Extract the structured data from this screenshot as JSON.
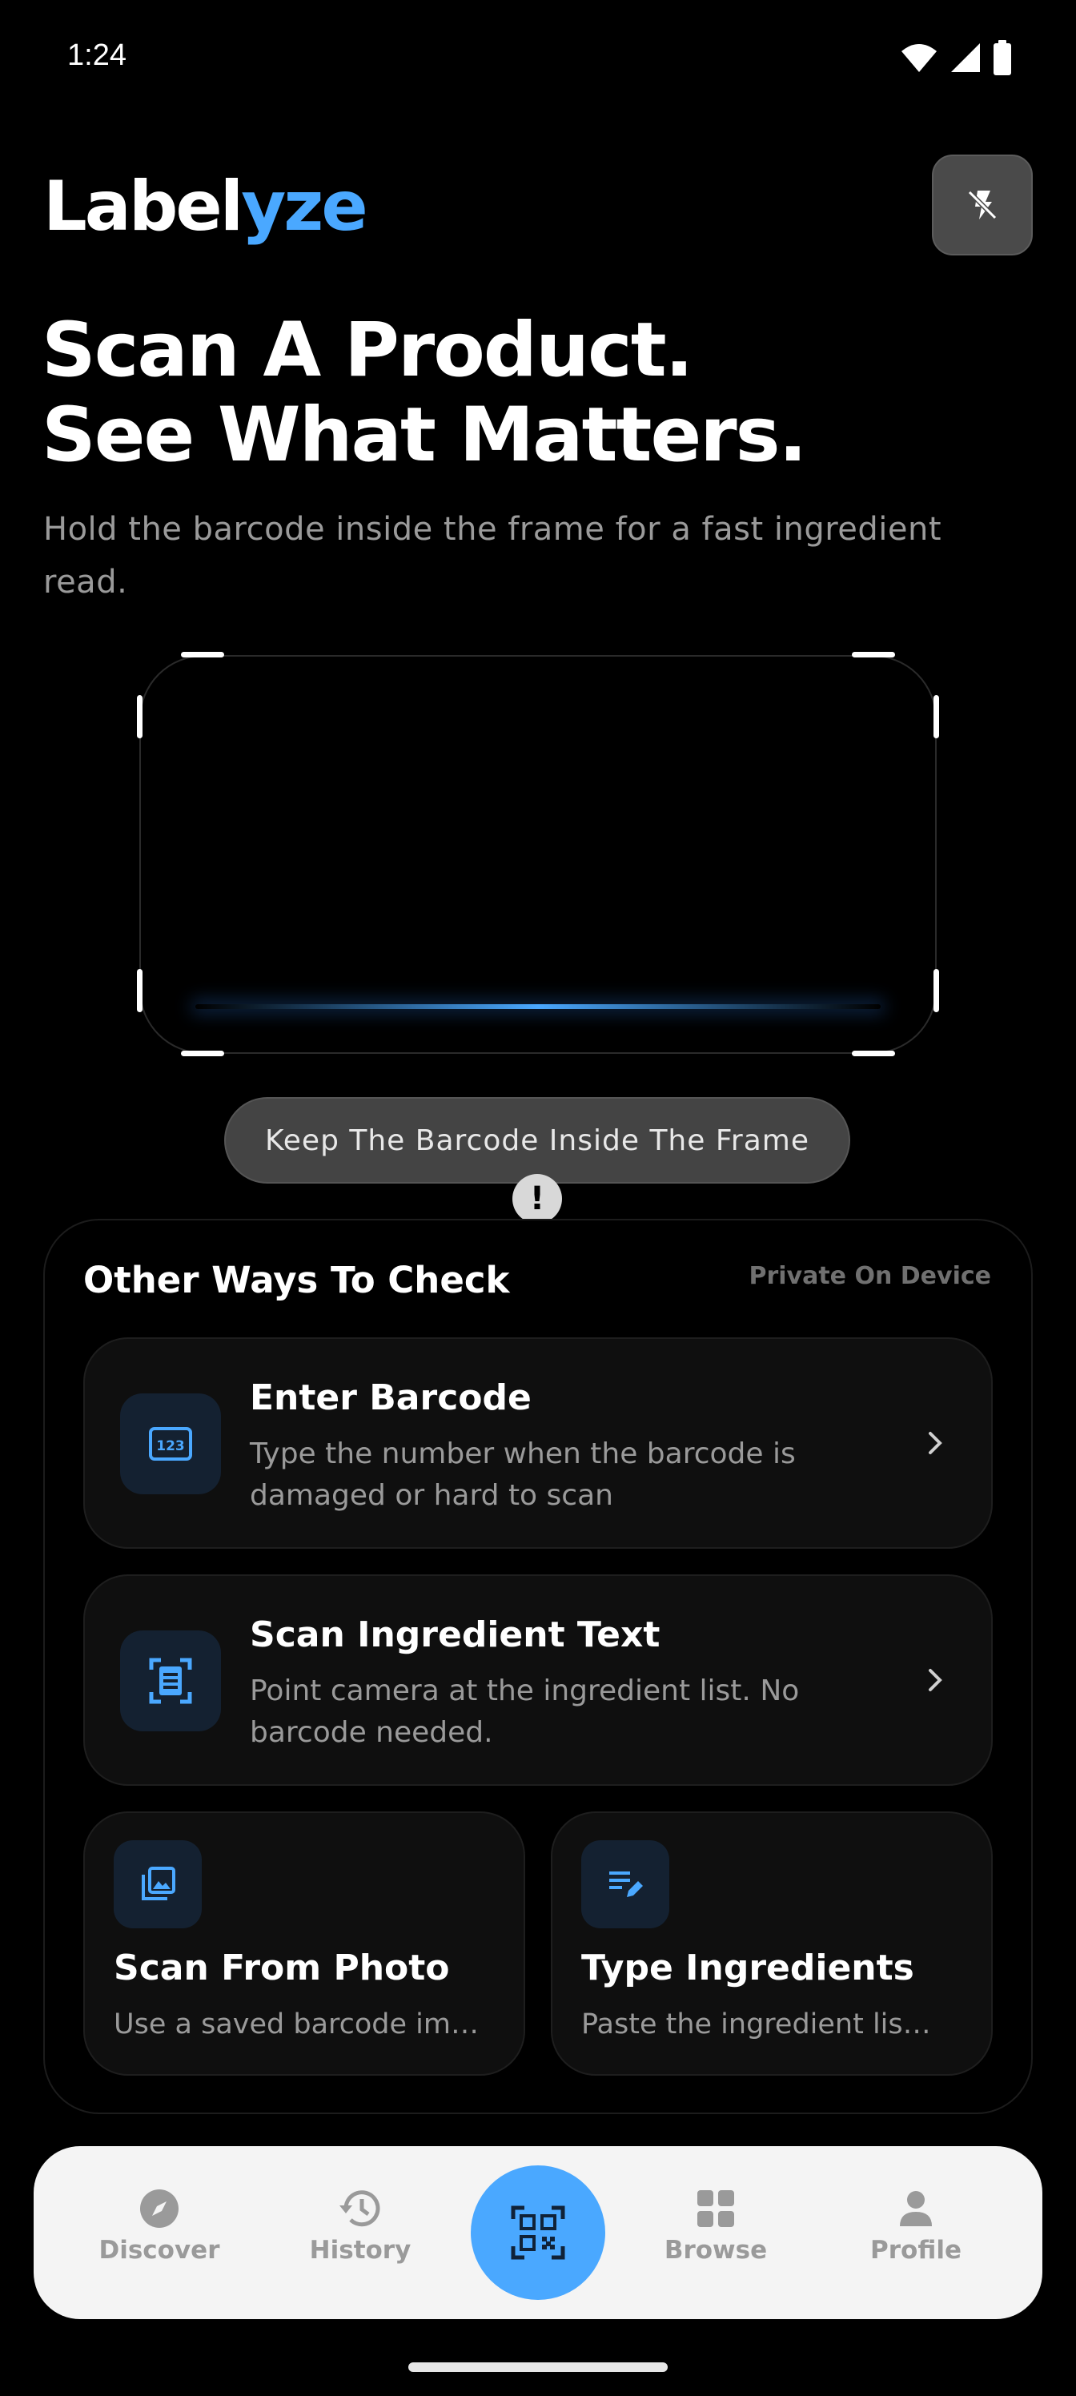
{
  "status_bar": {
    "time": "1:24"
  },
  "header": {
    "logo_main": "Label",
    "logo_accent": "yze",
    "flash_icon": "flash-off-icon"
  },
  "hero": {
    "headline_line1": "Scan A Product.",
    "headline_line2": "See What Matters.",
    "subline": "Hold the barcode inside the frame for a fast ingredient read."
  },
  "scanner": {
    "hint": "Keep The Barcode Inside The Frame",
    "hint_icon_glyph": "!"
  },
  "other_ways": {
    "title": "Other Ways To Check",
    "badge": "Private On Device",
    "options": [
      {
        "title": "Enter Barcode",
        "desc": "Type the number when the barcode is damaged or hard to scan",
        "icon": "barcode-123-icon"
      },
      {
        "title": "Scan Ingredient Text",
        "desc": "Point camera at the ingredient list. No barcode needed.",
        "icon": "document-scan-icon"
      }
    ],
    "tiles": [
      {
        "title": "Scan From Photo",
        "desc": "Use a saved barcode im…",
        "icon": "photo-library-icon"
      },
      {
        "title": "Type Ingredients",
        "desc": "Paste the ingredient lis…",
        "icon": "edit-list-icon"
      }
    ]
  },
  "nav": {
    "items": [
      {
        "label": "Discover",
        "icon": "compass-icon"
      },
      {
        "label": "History",
        "icon": "history-icon"
      },
      {
        "label": "Browse",
        "icon": "grid-icon"
      },
      {
        "label": "Profile",
        "icon": "person-icon"
      }
    ],
    "scan_icon": "qr-scan-icon"
  },
  "colors": {
    "accent": "#4aa8ff",
    "background": "#000000",
    "nav_background": "#f4f4f4"
  }
}
